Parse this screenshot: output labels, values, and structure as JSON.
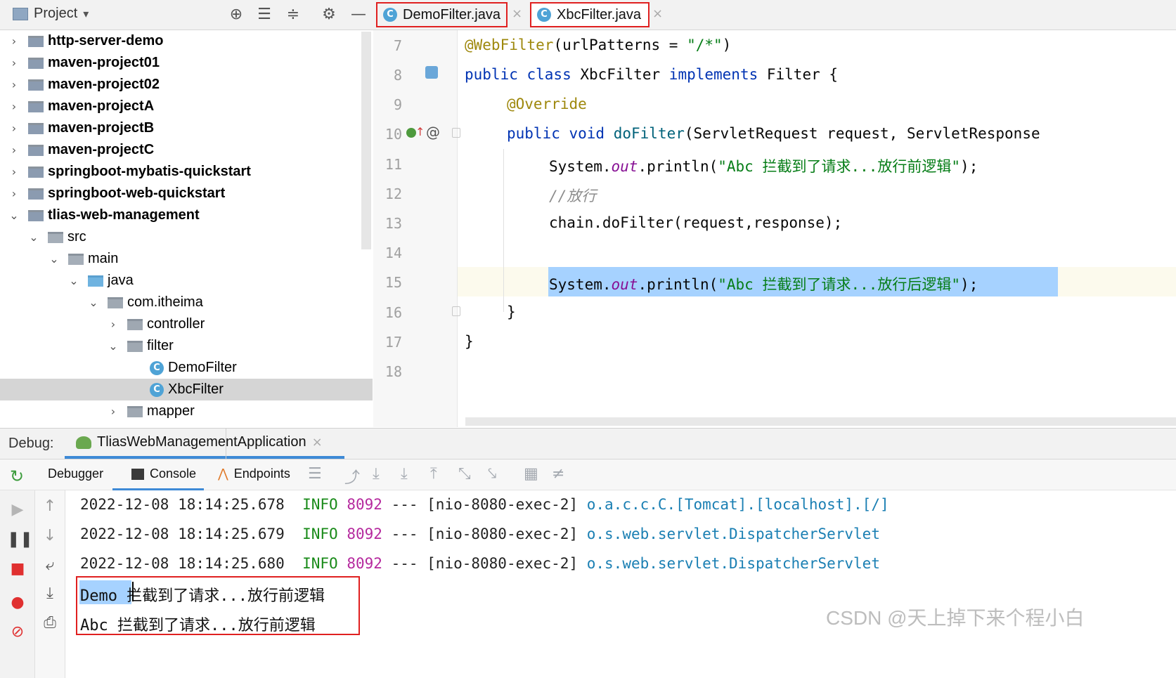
{
  "project_panel": {
    "title": "Project",
    "dropdown_glyph": "▾"
  },
  "toolbar_icons": [
    "crosshair-icon",
    "expand-all-icon",
    "collapse-all-icon",
    "gear-icon",
    "minimize-icon"
  ],
  "editor_tabs": [
    {
      "label": "DemoFilter.java",
      "icon": "C",
      "active": false
    },
    {
      "label": "XbcFilter.java",
      "icon": "C",
      "active": true
    }
  ],
  "tree": {
    "items": [
      {
        "label": "http-server-demo",
        "chev": "›",
        "bold": true
      },
      {
        "label": "maven-project01",
        "chev": "›",
        "bold": true
      },
      {
        "label": "maven-project02",
        "chev": "›",
        "bold": true
      },
      {
        "label": "maven-projectA",
        "chev": "›",
        "bold": true
      },
      {
        "label": "maven-projectB",
        "chev": "›",
        "bold": true
      },
      {
        "label": "maven-projectC",
        "chev": "›",
        "bold": true
      },
      {
        "label": "springboot-mybatis-quickstart",
        "chev": "›",
        "bold": true
      },
      {
        "label": "springboot-web-quickstart",
        "chev": "›",
        "bold": true
      },
      {
        "label": "tlias-web-management",
        "chev": "⌄",
        "bold": true
      },
      {
        "label": "src",
        "chev": "⌄"
      },
      {
        "label": "main",
        "chev": "⌄"
      },
      {
        "label": "java",
        "chev": "⌄"
      },
      {
        "label": "com.itheima",
        "chev": "⌄"
      },
      {
        "label": "controller",
        "chev": "›"
      },
      {
        "label": "filter",
        "chev": "⌄"
      },
      {
        "label": "DemoFilter",
        "class_icon": "C"
      },
      {
        "label": "XbcFilter",
        "class_icon": "C",
        "selected": true
      },
      {
        "label": "mapper",
        "chev": "›"
      }
    ]
  },
  "editor": {
    "line_numbers": [
      "7",
      "8",
      "9",
      "10",
      "11",
      "12",
      "13",
      "14",
      "15",
      "16",
      "17",
      "18"
    ],
    "l7": {
      "ann": "@WebFilter",
      "a": "(urlPatterns = ",
      "str": "\"/*\"",
      "b": ")"
    },
    "l8": {
      "kw1": "public class",
      "a": " XbcFilter ",
      "kw2": "implements",
      "b": " Filter {"
    },
    "l9": {
      "ann": "@Override"
    },
    "l10": {
      "kw": "public void",
      "mth": "doFilter",
      "a": "(ServletRequest request, ServletResponse"
    },
    "l11": {
      "a": "System.",
      "fld": "out",
      "b": ".println(",
      "str": "\"Abc 拦截到了请求...放行前逻辑\"",
      "c": ");"
    },
    "l12": {
      "cmt": "//放行"
    },
    "l13": {
      "a": "chain.doFilter(request,response);"
    },
    "l15": {
      "a": "System.",
      "fld": "out",
      "b": ".println(",
      "str": "\"Abc 拦截到了请求...放行后逻辑\"",
      "c": ");"
    },
    "l16": {
      "a": "}"
    },
    "l17": {
      "a": "}"
    },
    "gutter_marks": {
      "l10_at": "@"
    }
  },
  "debug": {
    "label": "Debug:",
    "run_config": "TliasWebManagementApplication",
    "close_glyph": "×",
    "tabs": [
      "Debugger",
      "Console",
      "Endpoints"
    ],
    "log_lines": [
      {
        "ts": "2022-12-08 18:14:25.678",
        "level": "INFO",
        "pid": "8092",
        "sep": "---",
        "thread": "[nio-8080-exec-2]",
        "logger": "o.a.c.c.C.[Tomcat].[localhost].[/]"
      },
      {
        "ts": "2022-12-08 18:14:25.679",
        "level": "INFO",
        "pid": "8092",
        "sep": "---",
        "thread": "[nio-8080-exec-2]",
        "logger": "o.s.web.servlet.DispatcherServlet"
      },
      {
        "ts": "2022-12-08 18:14:25.680",
        "level": "INFO",
        "pid": "8092",
        "sep": "---",
        "thread": "[nio-8080-exec-2]",
        "logger": "o.s.web.servlet.DispatcherServlet"
      }
    ],
    "output": {
      "line1_sel": "Demo ",
      "line1_rest": "拦截到了请求...放行前逻辑",
      "line2": "Abc 拦截到了请求...放行前逻辑"
    }
  },
  "watermark": "CSDN @天上掉下来个程小白",
  "colors": {
    "highlight_box": "#e02020",
    "selection": "#a6d2ff",
    "accent": "#3e8ad6"
  }
}
